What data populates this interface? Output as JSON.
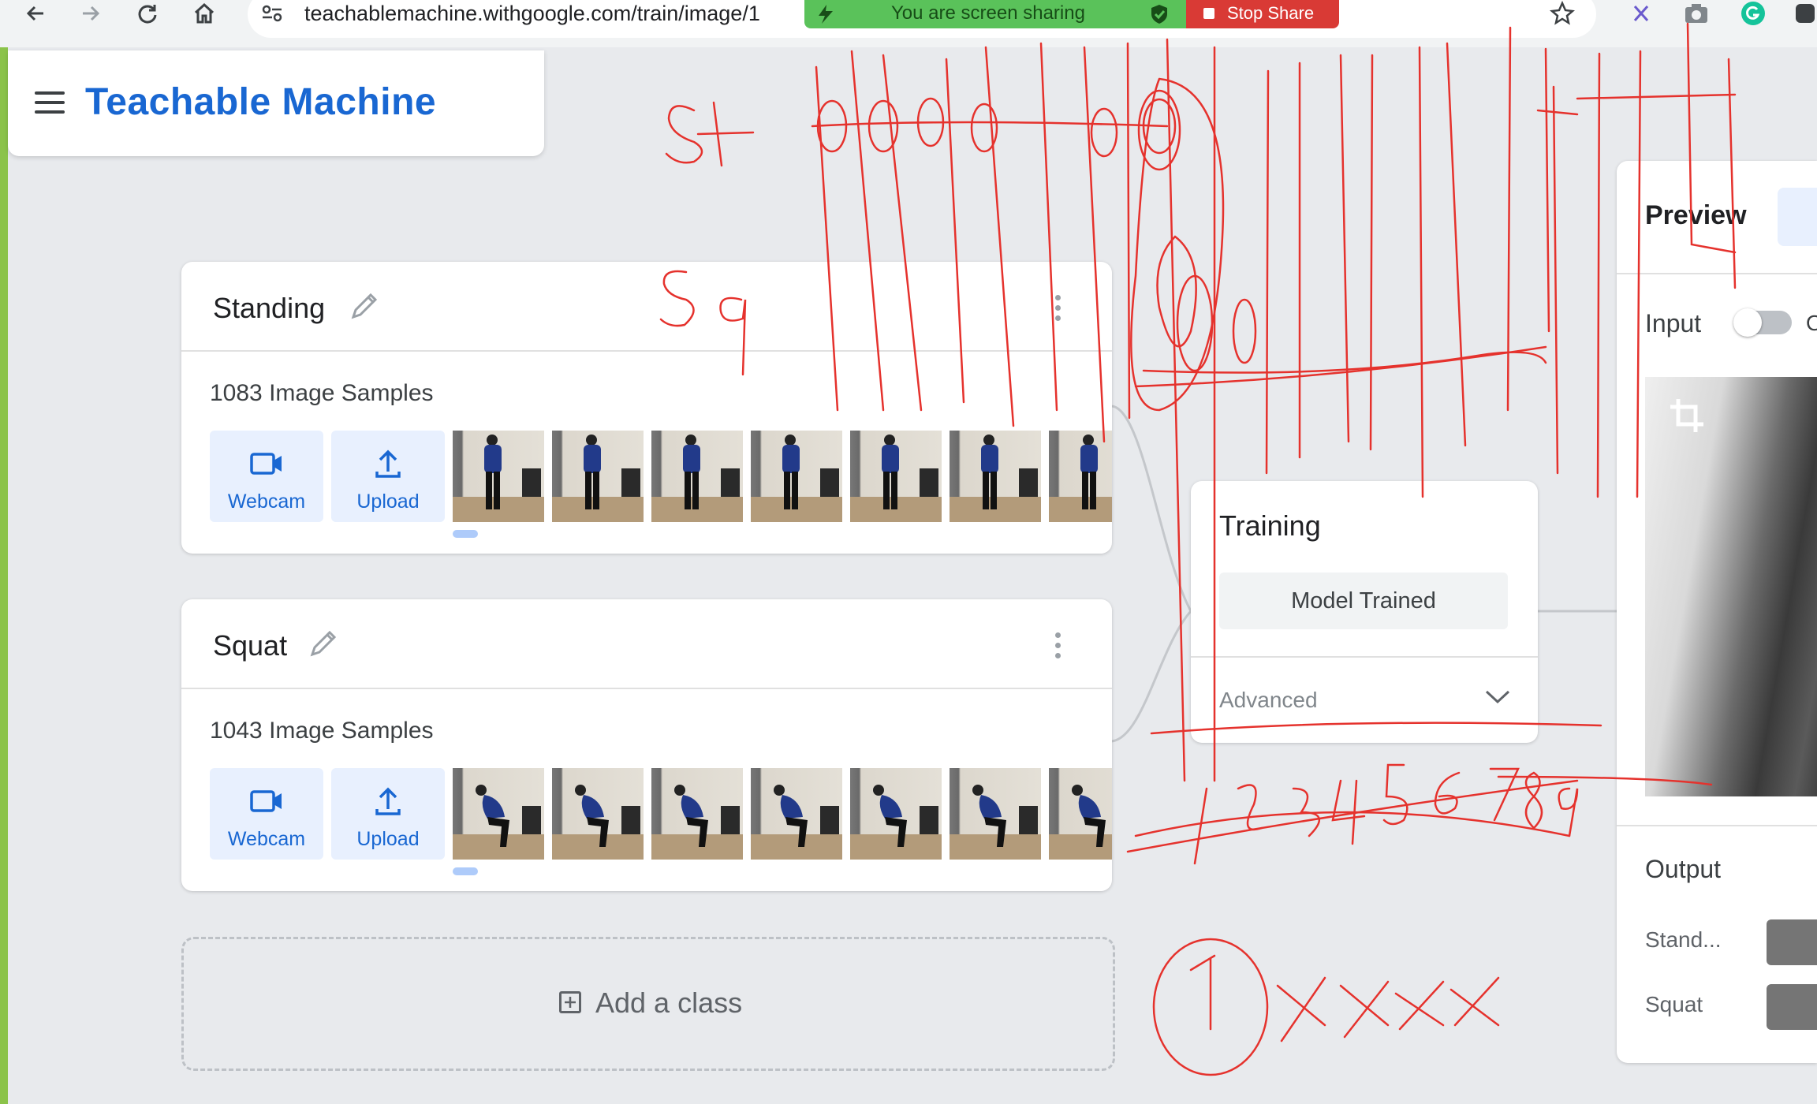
{
  "browser": {
    "url": "teachablemachine.withgoogle.com/train/image/1",
    "sharing_text": "You are screen sharing",
    "stop_share_label": "Stop Share"
  },
  "app": {
    "title": "Teachable Machine"
  },
  "classes": [
    {
      "name": "Standing",
      "sample_count": "1083 Image Samples",
      "webcam_label": "Webcam",
      "upload_label": "Upload"
    },
    {
      "name": "Squat",
      "sample_count": "1043 Image Samples",
      "webcam_label": "Webcam",
      "upload_label": "Upload"
    }
  ],
  "add_class_label": "Add a class",
  "training": {
    "title": "Training",
    "button_label": "Model Trained",
    "advanced_label": "Advanced"
  },
  "preview": {
    "title": "Preview",
    "input_label": "Input",
    "toggle_state": "off",
    "toggle_label": "O",
    "output_label": "Output",
    "outputs": [
      {
        "label": "Stand..."
      },
      {
        "label": "Squat"
      }
    ]
  },
  "colors": {
    "brand": "#1967d2",
    "share_green": "#5ac25a",
    "stop_red": "#d93a35",
    "ink": "#e5322d"
  }
}
